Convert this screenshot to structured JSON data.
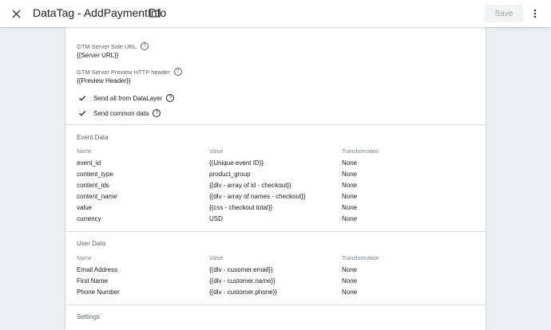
{
  "header": {
    "title": "DataTag - AddPaymentInfo",
    "save_label": "Save"
  },
  "fields": {
    "server_url": {
      "label": "GTM Server Side URL",
      "value": "{{Server URL}}"
    },
    "preview_header": {
      "label": "GTM Server Preview HTTP header",
      "value": "{{Preview Header}}"
    }
  },
  "options": [
    {
      "label": "Send all from DataLayer",
      "checked": true
    },
    {
      "label": "Send common data",
      "checked": true
    }
  ],
  "event_data": {
    "title": "Event Data",
    "columns": [
      "Name",
      "Value",
      "Transformation"
    ],
    "rows": [
      {
        "name": "event_id",
        "value": "{{Unique event ID}}",
        "transformation": "None"
      },
      {
        "name": "content_type",
        "value": "product_group",
        "transformation": "None"
      },
      {
        "name": "content_ids",
        "value": "{{dlv - array of id - checkout}}",
        "transformation": "None"
      },
      {
        "name": "content_name",
        "value": "{{dlv - array of names - checkout}}",
        "transformation": "None"
      },
      {
        "name": "value",
        "value": "{{css - checkout total}}",
        "transformation": "None"
      },
      {
        "name": "currency",
        "value": "USD",
        "transformation": "None"
      }
    ]
  },
  "user_data": {
    "title": "User Data",
    "columns": [
      "Name",
      "Value",
      "Transformation"
    ],
    "rows": [
      {
        "name": "Email Address",
        "value": "{{dlv - cusomer.email}}",
        "transformation": "None"
      },
      {
        "name": "First Name",
        "value": "{{dlv - customer.name}}",
        "transformation": "None"
      },
      {
        "name": "Phone Number",
        "value": "{{dlv - customer.phone}}",
        "transformation": "None"
      }
    ]
  },
  "settings": {
    "title": "Settings"
  },
  "icons": {
    "close": "close-icon",
    "folder": "folder-icon",
    "more": "more-vert-icon",
    "help": "help-icon",
    "check": "check-icon"
  }
}
